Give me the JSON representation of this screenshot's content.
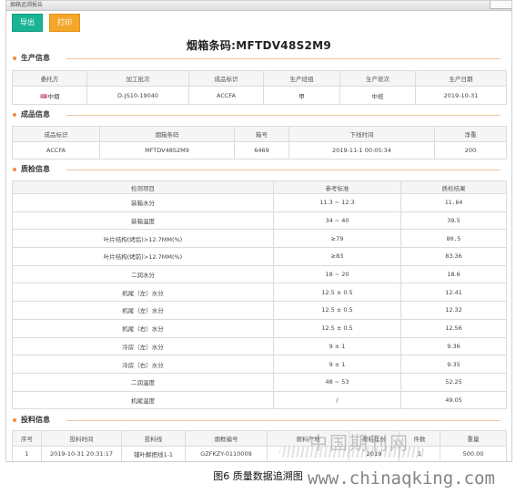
{
  "window": {
    "title": "烟箱追溯报告"
  },
  "toolbar": {
    "export_label": "导出",
    "print_label": "打印"
  },
  "page_title": "烟箱条码:MFTDV48S2M9",
  "sections": {
    "production": "生产信息",
    "product": "成品信息",
    "quality": "质检信息",
    "feeding": "投料信息"
  },
  "production_table": {
    "headers": [
      "委托方",
      "加工批次",
      "成品标识",
      "生产班组",
      "生产班次",
      "生产日期"
    ],
    "row": [
      "中烟",
      "D-JS10-19040",
      "ACCFA",
      "甲",
      "中班",
      "2019-10-31"
    ]
  },
  "product_table": {
    "headers": [
      "成品标识",
      "烟箱条码",
      "箱号",
      "下线时间",
      "净重"
    ],
    "row": [
      "ACCFA",
      "MFTDV48S2M9",
      "6469",
      "2019-11-1 00:05:34",
      "200"
    ]
  },
  "quality_table": {
    "headers": [
      "检测项目",
      "参考标准",
      "质检结果"
    ],
    "rows": [
      [
        "装箱水分",
        "11.3 ~ 12.3",
        "11.64"
      ],
      [
        "装箱温度",
        "34 ~ 40",
        "39.5"
      ],
      [
        "叶片结构(烤后)>12.7MM(%)",
        "≥79",
        "80.5"
      ],
      [
        "叶片结构(烤前)>12.7MM(%)",
        "≥83",
        "83.36"
      ],
      [
        "二润水分",
        "18 ~ 20",
        "18.6"
      ],
      [
        "机尾（左）水分",
        "12.5 ± 0.5",
        "12.41"
      ],
      [
        "机尾（左）水分",
        "12.5 ± 0.5",
        "12.32"
      ],
      [
        "机尾（右）水分",
        "12.5 ± 0.5",
        "12.56"
      ],
      [
        "冷房（左）水分",
        "9 ± 1",
        "9.36"
      ],
      [
        "冷房（右）水分",
        "9 ± 1",
        "9.35"
      ],
      [
        "二润温度",
        "48 ~ 53",
        "52.25"
      ],
      [
        "机尾温度",
        "/",
        "49.05"
      ]
    ]
  },
  "feeding_table": {
    "headers": [
      "序号",
      "投料时间",
      "投料线",
      "烟框编号",
      "原料产地",
      "原料年份",
      "件数",
      "重量"
    ],
    "row": [
      "1",
      "2019-10-31 20:31:17",
      "铺叶解把线1-1",
      "GZFKZY-0110009",
      "",
      "2019",
      "1",
      "500.00"
    ]
  },
  "caption": "图6  质量数据追溯图",
  "watermark": {
    "cn": "中国期刊网",
    "url": "www.chinaqking.com"
  },
  "colors": {
    "accent": "#f08c42",
    "export_button": "#1ab394",
    "print_button": "#f4a62a"
  }
}
